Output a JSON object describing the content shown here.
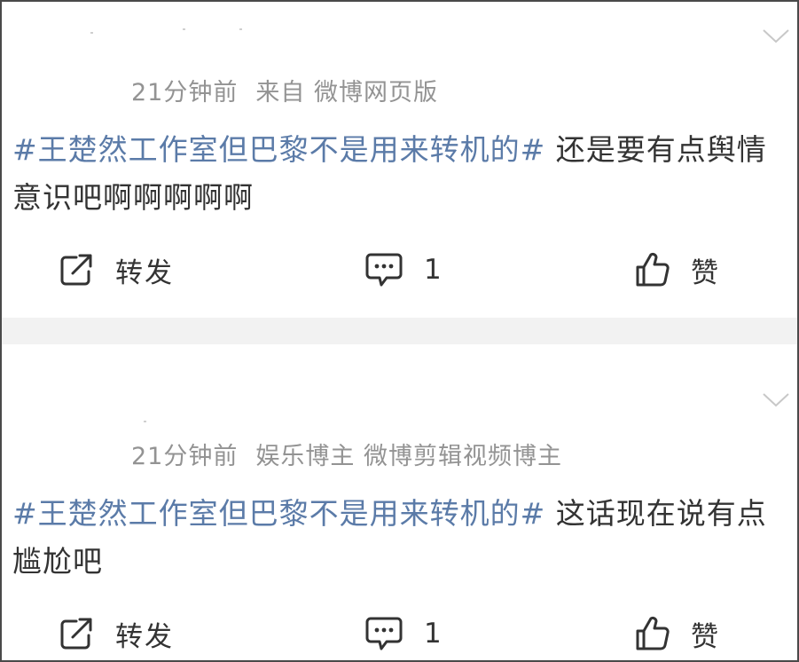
{
  "posts": [
    {
      "time": "21分钟前",
      "source": "来自 微博网页版",
      "topic": "#王楚然工作室但巴黎不是用来转机的#",
      "text": " 还是要有点舆情意识吧啊啊啊啊啊",
      "repost_label": "转发",
      "comment_count": "1",
      "like_label": "赞"
    },
    {
      "time": "21分钟前",
      "source": "娱乐博主 微博剪辑视频博主",
      "topic": "#王楚然工作室但巴黎不是用来转机的#",
      "text": " 这话现在说有点尴尬吧",
      "repost_label": "转发",
      "comment_count": "1",
      "like_label": "赞"
    }
  ],
  "colors": {
    "topic": "#5b7ba8",
    "meta": "#939393",
    "text": "#333333",
    "separator": "#f2f2f2"
  },
  "icons": [
    "chevron-down-icon",
    "repost-icon",
    "comment-icon",
    "like-icon"
  ]
}
